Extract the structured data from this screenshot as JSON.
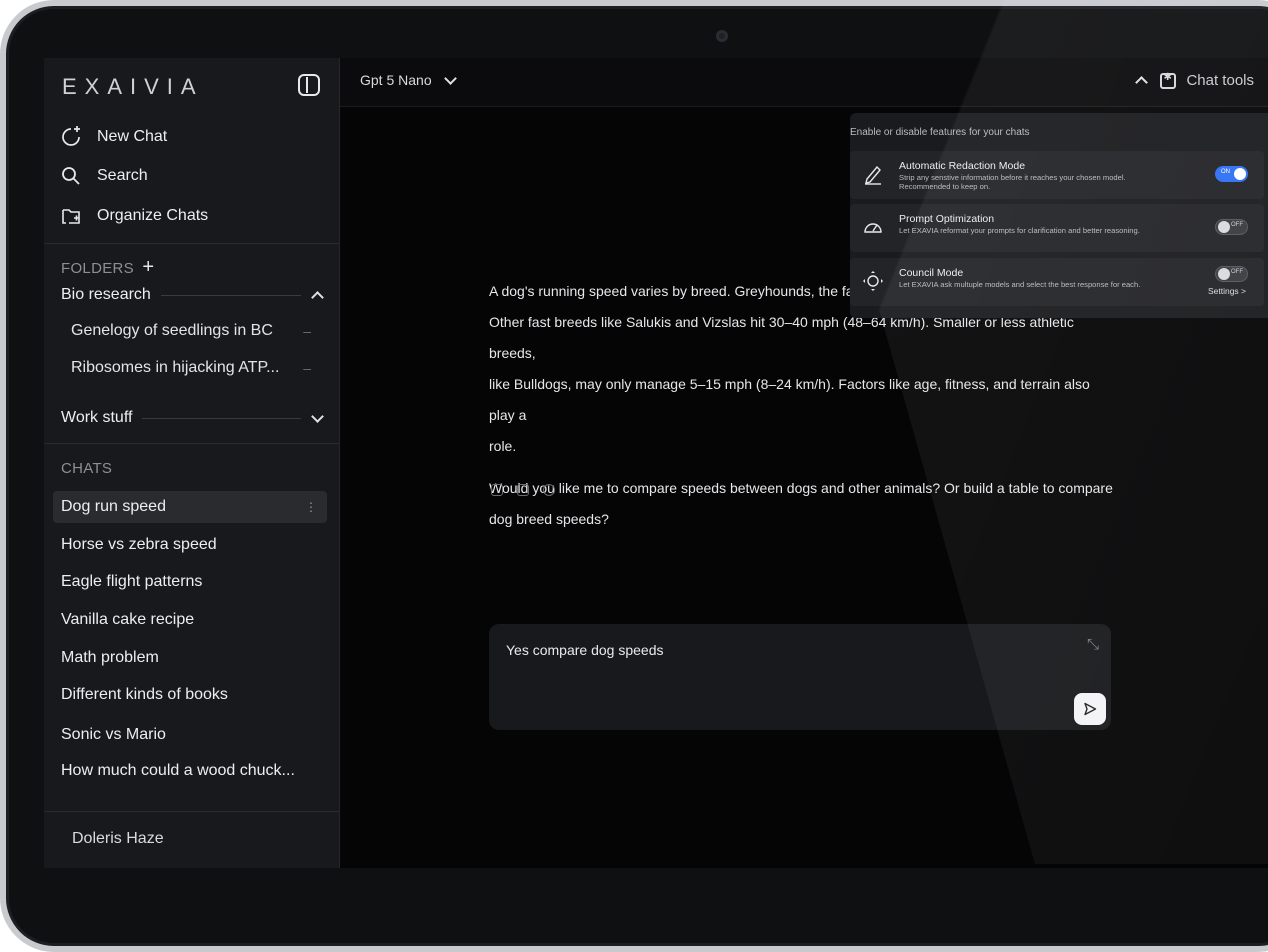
{
  "sidebar": {
    "brand": "EXAIVIA",
    "menu": [
      {
        "label": "New Chat",
        "icon": "new-chat-icon"
      },
      {
        "label": "Search",
        "icon": "search-icon"
      },
      {
        "label": "Organize Chats",
        "icon": "organize-chats-icon"
      }
    ],
    "folders_label": "FOLDERS",
    "folders": [
      {
        "name": "Bio research",
        "expanded": true,
        "items": [
          "Genelogy of seedlings in BC",
          "Ribosomes in hijacking ATP..."
        ]
      },
      {
        "name": "Work stuff",
        "expanded": false,
        "items": []
      }
    ],
    "chats_label": "CHATS",
    "chats": [
      "Dog run speed",
      "Horse vs zebra speed",
      "Eagle flight patterns",
      "Vanilla cake recipe",
      "Math problem",
      "Different kinds of books",
      "Sonic vs Mario",
      "How much could a wood chuck..."
    ],
    "active_chat": "Dog run speed",
    "user_name": "Doleris Haze"
  },
  "header": {
    "model": "Gpt 5 Nano",
    "chat_tools_label": "Chat tools"
  },
  "tools_panel": {
    "heading": "Enable or disable features for your chats",
    "tools": [
      {
        "title": "Automatic Redaction Mode",
        "description": "Strip any senstive information before it reaches your chosen model. Recommended to keep on.",
        "state": "ON",
        "icon": "pen-icon"
      },
      {
        "title": "Prompt Optimization",
        "description": "Let EXAVIA reformat your prompts for clarification and better reasoning.",
        "state": "OFF",
        "icon": "speedometer-icon"
      },
      {
        "title": "Council Mode",
        "description": "Let EXAVIA ask multuple models and select the best response for each.",
        "state": "OFF",
        "icon": "council-icon"
      }
    ],
    "settings_link": "Settings >",
    "accent": "#2e6ff3"
  },
  "conversation": {
    "message_p1_line1": "A dog's running speed varies by breed. Greyhounds, the fa",
    "message_p1_line2": "Other fast breeds like Salukis and Vizslas hit 30–40 mph (48–64 km/h). Smaller or less athletic breeds,",
    "message_p1_line3": "like Bulldogs, may only manage 5–15 mph (8–24 km/h). Factors like age, fitness, and terrain also play a",
    "message_p1_line4": "role.",
    "message_p2": "Would you like me to compare speeds between dogs and other animals? Or build a table to compare dog breed speeds?",
    "actions": [
      "share-icon",
      "copy-icon",
      "regenerate-icon"
    ]
  },
  "composer": {
    "value": "Yes compare dog speeds"
  }
}
